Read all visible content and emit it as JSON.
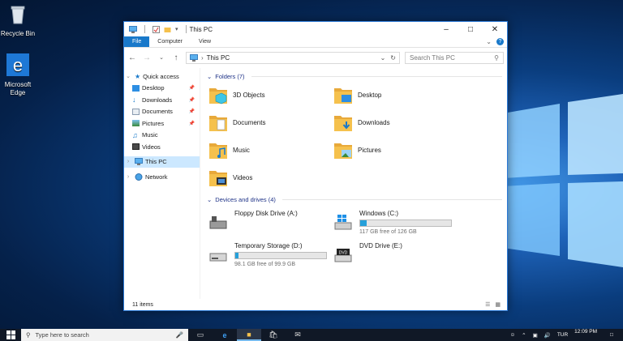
{
  "desktop": {
    "icons": [
      {
        "label": "Recycle Bin",
        "icon": "recycle-bin-icon"
      },
      {
        "label": "Microsoft Edge",
        "icon": "edge-icon"
      }
    ]
  },
  "window": {
    "title": "This PC",
    "ribbon_tabs": [
      "File",
      "Computer",
      "View"
    ],
    "address_path": "This PC",
    "search_placeholder": "Search This PC"
  },
  "nav_pane": {
    "items": [
      {
        "label": "Quick access",
        "icon": "star-icon",
        "expanded": true
      },
      {
        "label": "Desktop",
        "icon": "desktop-folder-icon",
        "pinned": true
      },
      {
        "label": "Downloads",
        "icon": "downloads-icon",
        "pinned": true
      },
      {
        "label": "Documents",
        "icon": "documents-icon",
        "pinned": true
      },
      {
        "label": "Pictures",
        "icon": "pictures-icon",
        "pinned": true
      },
      {
        "label": "Music",
        "icon": "music-icon"
      },
      {
        "label": "Videos",
        "icon": "videos-icon"
      },
      {
        "label": "This PC",
        "icon": "pc-icon",
        "selected": true
      },
      {
        "label": "Network",
        "icon": "network-icon"
      }
    ]
  },
  "folders": {
    "header": "Folders (7)",
    "items": [
      {
        "name": "3D Objects",
        "icon": "3d-objects-folder-icon"
      },
      {
        "name": "Desktop",
        "icon": "desktop-folder-icon"
      },
      {
        "name": "Documents",
        "icon": "documents-folder-icon"
      },
      {
        "name": "Downloads",
        "icon": "downloads-folder-icon"
      },
      {
        "name": "Music",
        "icon": "music-folder-icon"
      },
      {
        "name": "Pictures",
        "icon": "pictures-folder-icon"
      },
      {
        "name": "Videos",
        "icon": "videos-folder-icon"
      }
    ]
  },
  "drives": {
    "header": "Devices and drives (4)",
    "items": [
      {
        "name": "Floppy Disk Drive (A:)",
        "icon": "floppy-drive-icon"
      },
      {
        "name": "Windows (C:)",
        "icon": "windows-drive-icon",
        "free": "117 GB free of 126 GB",
        "used_fraction": 0.07
      },
      {
        "name": "Temporary Storage (D:)",
        "icon": "hard-drive-icon",
        "free": "98.1 GB free of 99.9 GB",
        "used_fraction": 0.018
      },
      {
        "name": "DVD Drive (E:)",
        "icon": "dvd-drive-icon"
      }
    ]
  },
  "status": {
    "count": "11 items"
  },
  "taskbar": {
    "search_placeholder": "Type here to search",
    "time": "12:09 PM",
    "language": "TUR"
  },
  "colors": {
    "accent": "#1979ca",
    "folder": "#f5c14d",
    "selection": "#cce8ff",
    "drive_bar": "#26a0da"
  }
}
